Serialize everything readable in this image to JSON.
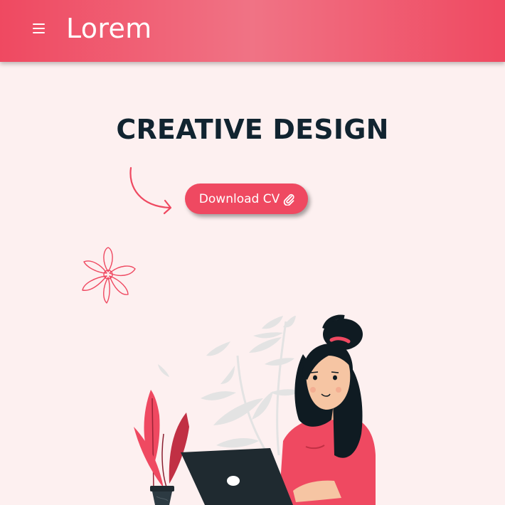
{
  "header": {
    "brand": "Lorem",
    "menu_icon": "hamburger-menu-icon"
  },
  "hero": {
    "title": "CREATIVE DESIGN",
    "cv_button_label": "Download CV",
    "cv_button_icon": "paperclip-icon"
  },
  "colors": {
    "accent": "#ef4961",
    "header_gradient_light": "#f07385",
    "background": "#fdf0f0",
    "heading": "#112430",
    "laptop": "#1f2a30",
    "leaf_grey": "#e3e3e3",
    "skin": "#f6c5a3"
  },
  "decorations": [
    "curved-arrow-doodle",
    "flower-doodle",
    "woman-at-laptop-illustration",
    "potted-plant"
  ]
}
